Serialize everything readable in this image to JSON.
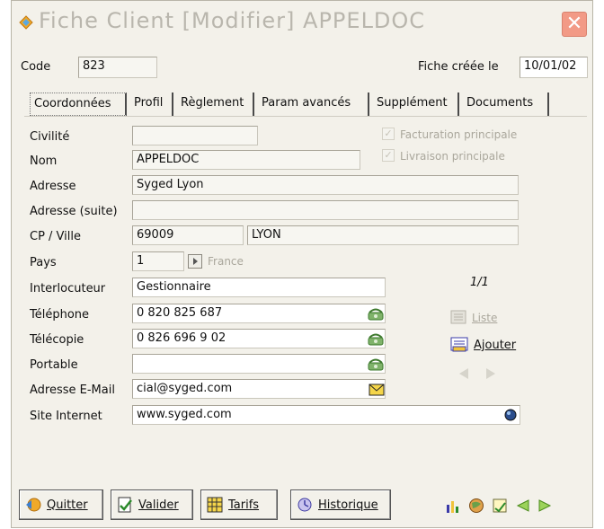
{
  "window": {
    "title": "Fiche Client [Modifier]  APPELDOC"
  },
  "header": {
    "code_label": "Code",
    "code_value": "823",
    "created_label": "Fiche créée le",
    "created_value": "10/01/02"
  },
  "tabs": [
    {
      "label": "Coordonnées",
      "active": true
    },
    {
      "label": "Profil",
      "active": false
    },
    {
      "label": "Règlement",
      "active": false
    },
    {
      "label": "Param avancés",
      "active": false
    },
    {
      "label": "Supplément",
      "active": false
    },
    {
      "label": "Documents",
      "active": false
    }
  ],
  "form": {
    "civilite": {
      "label": "Civilité",
      "value": ""
    },
    "nom": {
      "label": "Nom",
      "value": "APPELDOC"
    },
    "adresse": {
      "label": "Adresse",
      "value": "Syged Lyon"
    },
    "adresse_suite": {
      "label": "Adresse (suite)",
      "value": ""
    },
    "cp_ville": {
      "label": "CP / Ville",
      "cp": "69009",
      "ville": "LYON"
    },
    "pays": {
      "label": "Pays",
      "code": "1",
      "name": "France"
    },
    "interlocuteur": {
      "label": "Interlocuteur",
      "value": "Gestionnaire"
    },
    "telephone": {
      "label": "Téléphone",
      "value": "0 820 825 687"
    },
    "telecopie": {
      "label": "Télécopie",
      "value": "0 826 696 9 02"
    },
    "portable": {
      "label": "Portable",
      "value": ""
    },
    "email": {
      "label": "Adresse E-Mail",
      "value": "cial@syged.com"
    },
    "site": {
      "label": "Site Internet",
      "value": "www.syged.com"
    }
  },
  "options": {
    "facturation": {
      "label": "Facturation principale",
      "checked": true
    },
    "livraison": {
      "label": "Livraison principale",
      "checked": true
    }
  },
  "contacts_nav": {
    "counter": "1/1",
    "liste_label": "Liste",
    "ajouter_label": "Ajouter"
  },
  "buttons": {
    "quitter": "Quitter",
    "valider": "Valider",
    "tarifs": "Tarifs",
    "historique": "Historique"
  },
  "colors": {
    "window_bg": "#f3f1ea",
    "title_text": "#b9b6ad",
    "close_bg": "#f29a86",
    "field_bg": "#f7f6f1"
  }
}
